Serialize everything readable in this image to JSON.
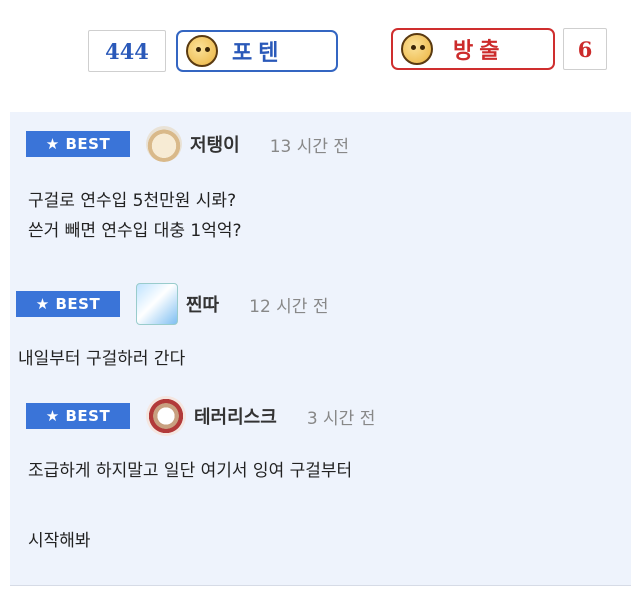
{
  "votes": {
    "up_count": "444",
    "up_label": "포텐",
    "down_label": "방출",
    "down_count": "6",
    "up_icon": "thumbs-up-face-icon",
    "down_icon": "thumbs-down-face-icon",
    "up_color": "#2a59b9",
    "down_color": "#cc2b2b"
  },
  "comments": [
    {
      "badge": "★ BEST",
      "author": "저탱이",
      "time": "13 시간 전",
      "lines": [
        "구걸로 연수입 5천만원 시롸?",
        "쓴거 빼면 연수입 대충 1억억?"
      ]
    },
    {
      "badge": "★ BEST",
      "author": "찐따",
      "time": "12 시간 전",
      "lines": [
        "내일부터 구걸하러 간다"
      ]
    },
    {
      "badge": "★ BEST",
      "author": "테러리스크",
      "time": "3 시간 전",
      "lines": [
        "조급하게 하지말고 일단 여기서 잉여 구걸부터",
        "시작해봐"
      ]
    }
  ],
  "colors": {
    "best_badge": "#3a74d8",
    "comments_bg": "#eef3fc"
  }
}
